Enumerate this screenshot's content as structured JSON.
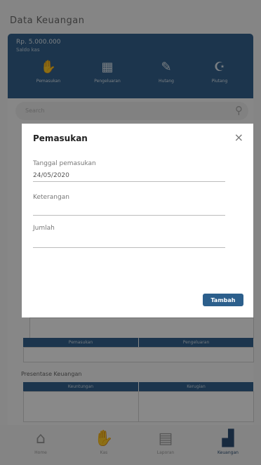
{
  "app": {
    "title": "Data Keuangan"
  },
  "summary": {
    "saldo_amount": "Rp. 5.000.000",
    "saldo_label": "Saldo kas",
    "actions": [
      {
        "icon": "hand-coins-icon",
        "glyph": "✋",
        "label": "Pemasukan"
      },
      {
        "icon": "cash-register-icon",
        "glyph": "▦",
        "label": "Pengeluaran"
      },
      {
        "icon": "notebook-icon",
        "glyph": "✎",
        "label": "Hutang"
      },
      {
        "icon": "money-bag-icon",
        "glyph": "☪",
        "label": "Piutang"
      }
    ]
  },
  "search": {
    "placeholder": "Search"
  },
  "table1": {
    "col1": "Pemasukan",
    "col2": "Pengeluaran"
  },
  "section2": {
    "title": "Presentase Keuangan",
    "col1": "Keuntungan",
    "col2": "Kerugian"
  },
  "bottom_nav": [
    {
      "icon": "home-icon",
      "glyph": "⌂",
      "label": "Home"
    },
    {
      "icon": "hand-icon",
      "glyph": "✋",
      "label": "Kas"
    },
    {
      "icon": "report-icon",
      "glyph": "▤",
      "label": "Laporan"
    },
    {
      "icon": "chart-icon",
      "glyph": "▟",
      "label": "Keuangan"
    }
  ],
  "modal": {
    "title": "Pemasukan",
    "close_glyph": "×",
    "date_label": "Tanggal pemasukan",
    "date_value": "24/05/2020",
    "desc_label": "Keterangan",
    "desc_value": "",
    "amount_label": "Jumlah",
    "amount_value": "",
    "submit_label": "Tambah"
  },
  "colors": {
    "primary": "#34628c",
    "button": "#2c5f8c"
  }
}
